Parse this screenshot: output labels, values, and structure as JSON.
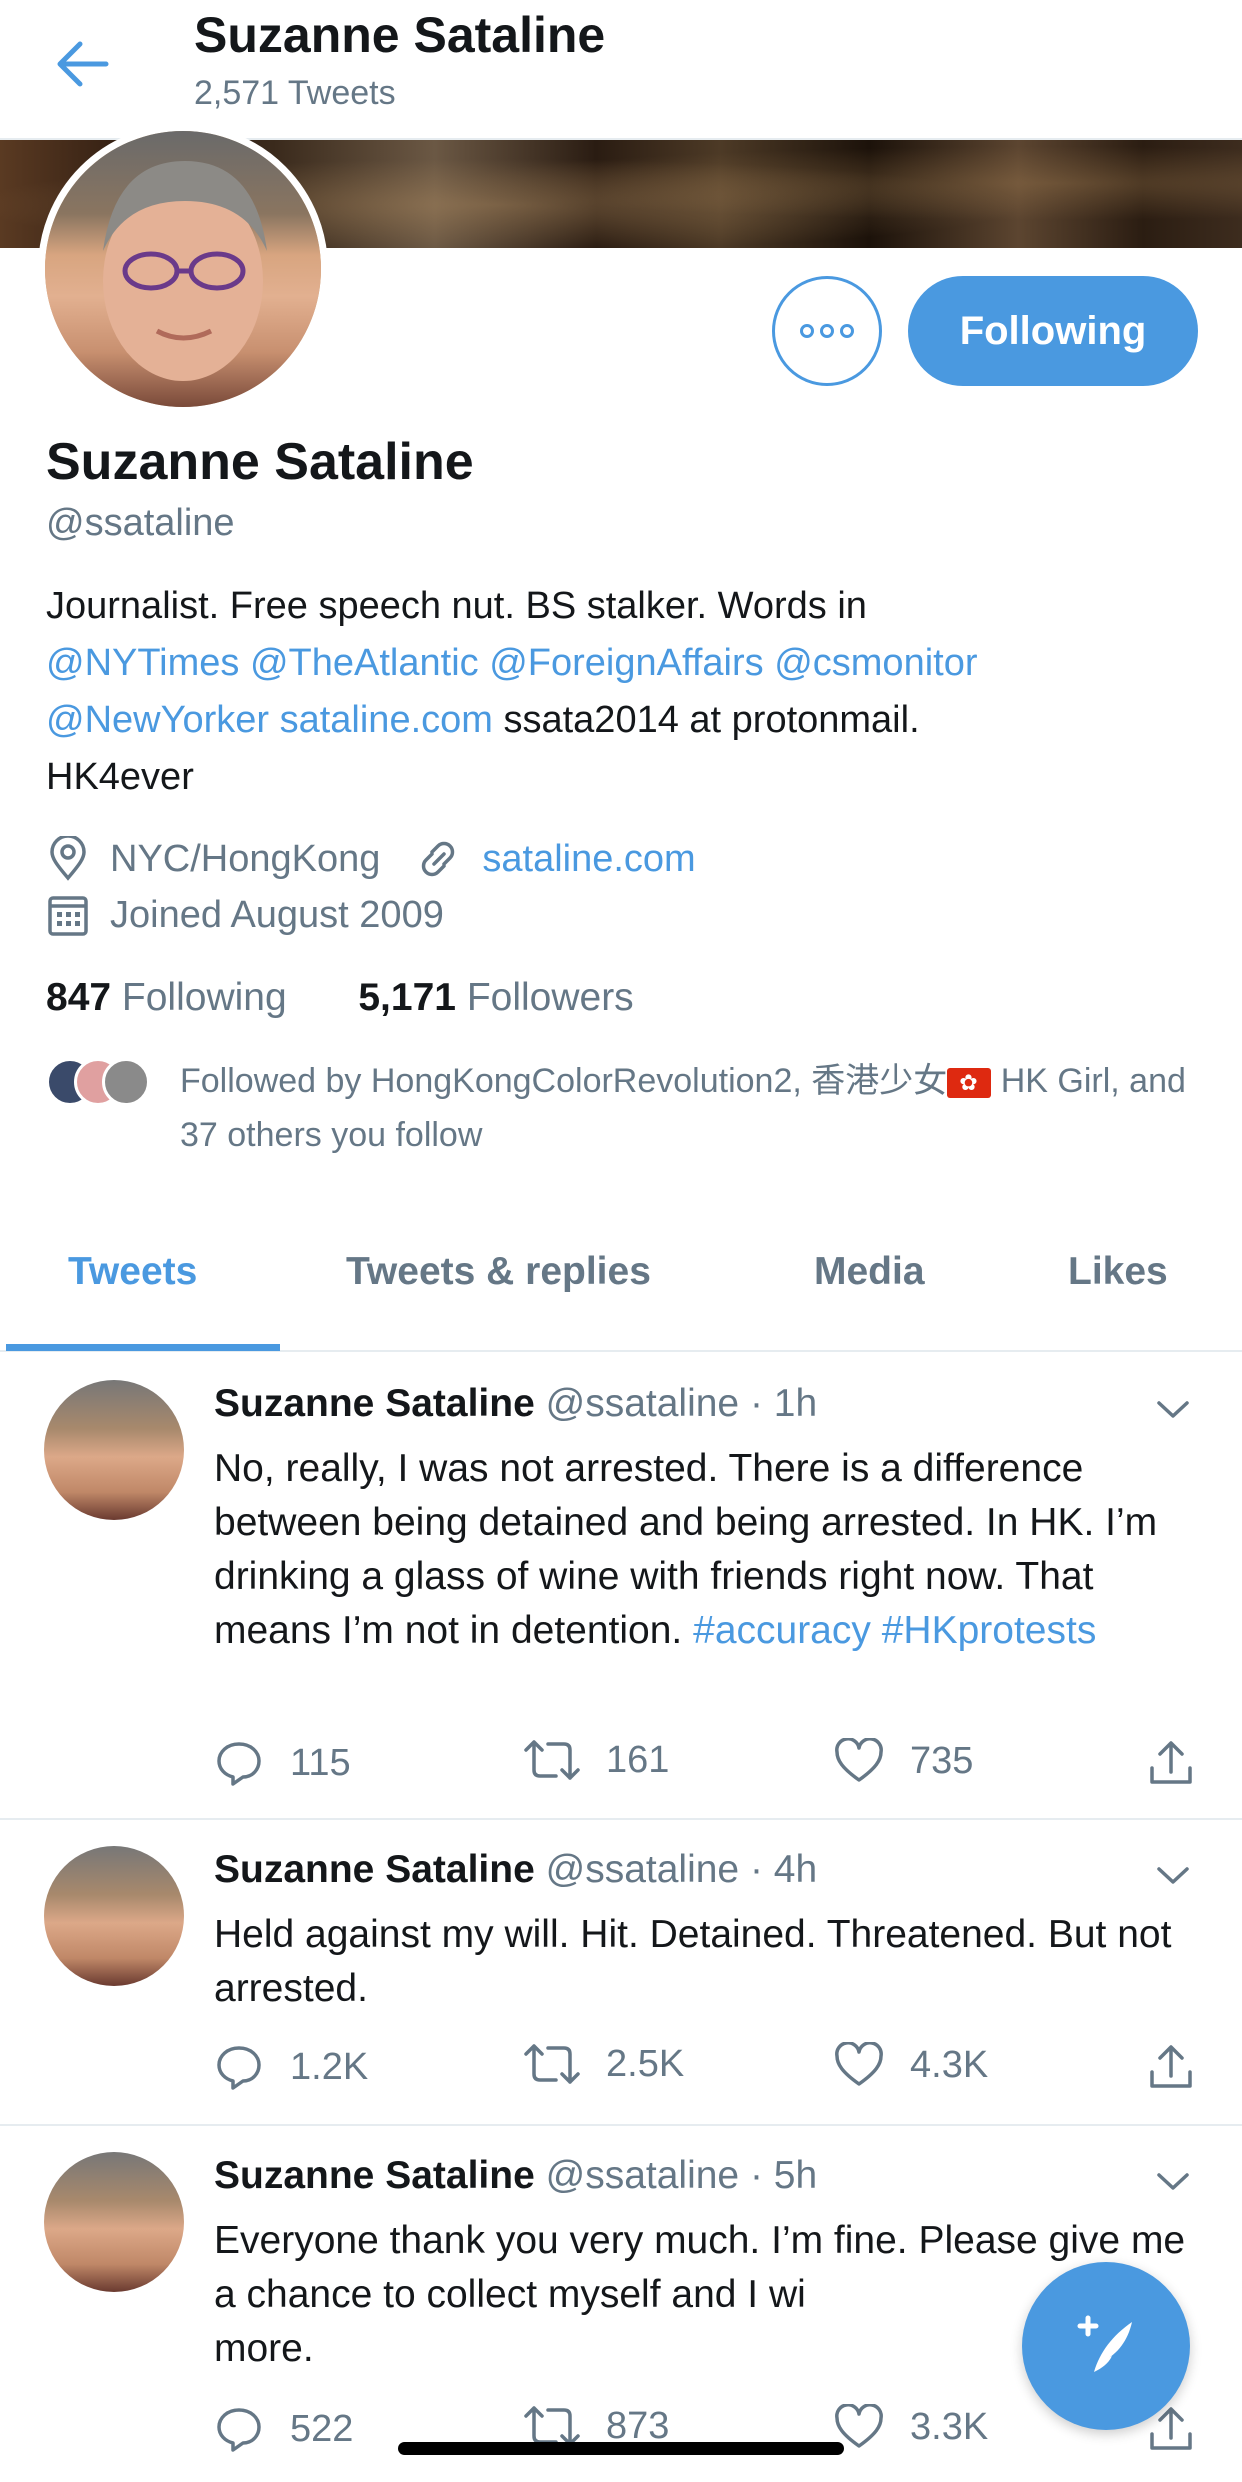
{
  "header": {
    "title": "Suzanne Sataline",
    "subtitle": "2,571 Tweets"
  },
  "profile": {
    "name": "Suzanne Sataline",
    "handle": "@ssataline",
    "follow_button": "Following",
    "bio": {
      "line1": "Journalist. Free speech nut. BS stalker. Words in",
      "mentions_line2": [
        "@NYTimes",
        "@TheAtlantic",
        "@ForeignAffairs",
        "@csmonitor"
      ],
      "mention_line3": "@NewYorker",
      "link_line3": "sataline.com",
      "text_line3": "ssata2014 at protonmail.",
      "line4": "HK4ever"
    },
    "location": "NYC/HongKong",
    "website": "sataline.com",
    "joined": "Joined August 2009",
    "following_count": "847",
    "following_label": "Following",
    "followers_count": "5,171",
    "followers_label": "Followers",
    "followed_by_prefix": "Followed by HongKongColorRevolution2, 香港少女",
    "followed_by_suffix": " HK Girl, and 37 others you follow"
  },
  "tabs": [
    {
      "label": "Tweets",
      "active": true
    },
    {
      "label": "Tweets & replies",
      "active": false
    },
    {
      "label": "Media",
      "active": false
    },
    {
      "label": "Likes",
      "active": false
    }
  ],
  "tweets": [
    {
      "name": "Suzanne Sataline",
      "handle": "@ssataline",
      "time": "1h",
      "text": "No, really, I was not arrested. There is a difference between being detained and being arrested. In HK. I’m drinking a glass of wine with friends right now. That means I’m not in detention.",
      "hashtag1": "#accuracy",
      "hashtag2": "#HKprotests",
      "replies": "115",
      "retweets": "161",
      "likes": "735"
    },
    {
      "name": "Suzanne Sataline",
      "handle": "@ssataline",
      "time": "4h",
      "text": "Held against my will. Hit. Detained. Threatened. But not arrested.",
      "replies": "1.2K",
      "retweets": "2.5K",
      "likes": "4.3K"
    },
    {
      "name": "Suzanne Sataline",
      "handle": "@ssataline",
      "time": "5h",
      "text": "Everyone thank you very much. I’m fine. Please give me a chance to collect myself and I wi",
      "text_end": "more.",
      "replies": "522",
      "retweets": "873",
      "likes": "3.3K"
    }
  ],
  "colors": {
    "accent": "#4a99e0",
    "text": "#14171a",
    "secondary": "#657786",
    "divider": "#e6ecf0"
  },
  "icons": [
    "back-arrow-icon",
    "more-dots-icon",
    "location-pin-icon",
    "link-icon",
    "calendar-icon",
    "reply-icon",
    "retweet-icon",
    "like-heart-icon",
    "share-icon",
    "chevron-down-icon",
    "compose-tweet-icon"
  ]
}
